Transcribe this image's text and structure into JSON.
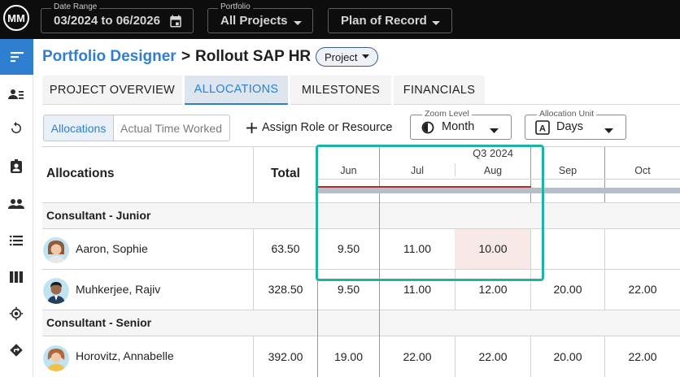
{
  "topbar": {
    "logo_text": "MM",
    "date_range": {
      "label": "Date Range",
      "value": "03/2024 to 06/2026"
    },
    "portfolio": {
      "label": "Portfolio",
      "value": "All Projects"
    },
    "plan": {
      "value": "Plan of Record"
    }
  },
  "sidebar": {
    "icons": [
      "menu-icon",
      "user-list-icon",
      "refresh-icon",
      "badge-icon",
      "people-icon",
      "list-icon",
      "columns-icon",
      "target-icon",
      "directions-icon"
    ]
  },
  "header": {
    "breadcrumb_root": "Portfolio Designer",
    "separator": ">",
    "title": "Rollout SAP HR",
    "type_badge": "Project"
  },
  "tabs": [
    {
      "label": "PROJECT OVERVIEW",
      "active": false
    },
    {
      "label": "ALLOCATIONS",
      "active": true
    },
    {
      "label": "MILESTONES",
      "active": false
    },
    {
      "label": "FINANCIALS",
      "active": false
    }
  ],
  "toolbar": {
    "view_toggle": [
      "Allocations",
      "Actual Time Worked"
    ],
    "add_role": "Assign Role or Resource",
    "zoom": {
      "label": "Zoom Level",
      "value": "Month"
    },
    "unit": {
      "label": "Allocation Unit",
      "value": "Days"
    }
  },
  "grid": {
    "col_allocations": "Allocations",
    "col_total": "Total",
    "quarter_label": "Q3 2024",
    "months": [
      "Jun",
      "Jul",
      "Aug",
      "Sep",
      "Oct"
    ],
    "groups": [
      {
        "name": "Consultant - Junior",
        "rows": [
          {
            "name": "Aaron, Sophie",
            "total": "63.50",
            "values": [
              "9.50",
              "11.00",
              "10.00",
              "",
              ""
            ]
          },
          {
            "name": "Muhkerjee, Rajiv",
            "total": "328.50",
            "values": [
              "9.50",
              "11.00",
              "12.00",
              "20.00",
              "22.00"
            ]
          }
        ]
      },
      {
        "name": "Consultant - Senior",
        "rows": [
          {
            "name": "Horovitz, Annabelle",
            "total": "392.00",
            "values": [
              "19.00",
              "22.00",
              "22.00",
              "20.00",
              "22.00"
            ]
          }
        ]
      }
    ]
  },
  "colors": {
    "accent": "#2f7fd0",
    "highlight": "#1fb3a5",
    "over_alloc_bg": "#f6e9e7",
    "timeline_red": "#a9302c"
  }
}
